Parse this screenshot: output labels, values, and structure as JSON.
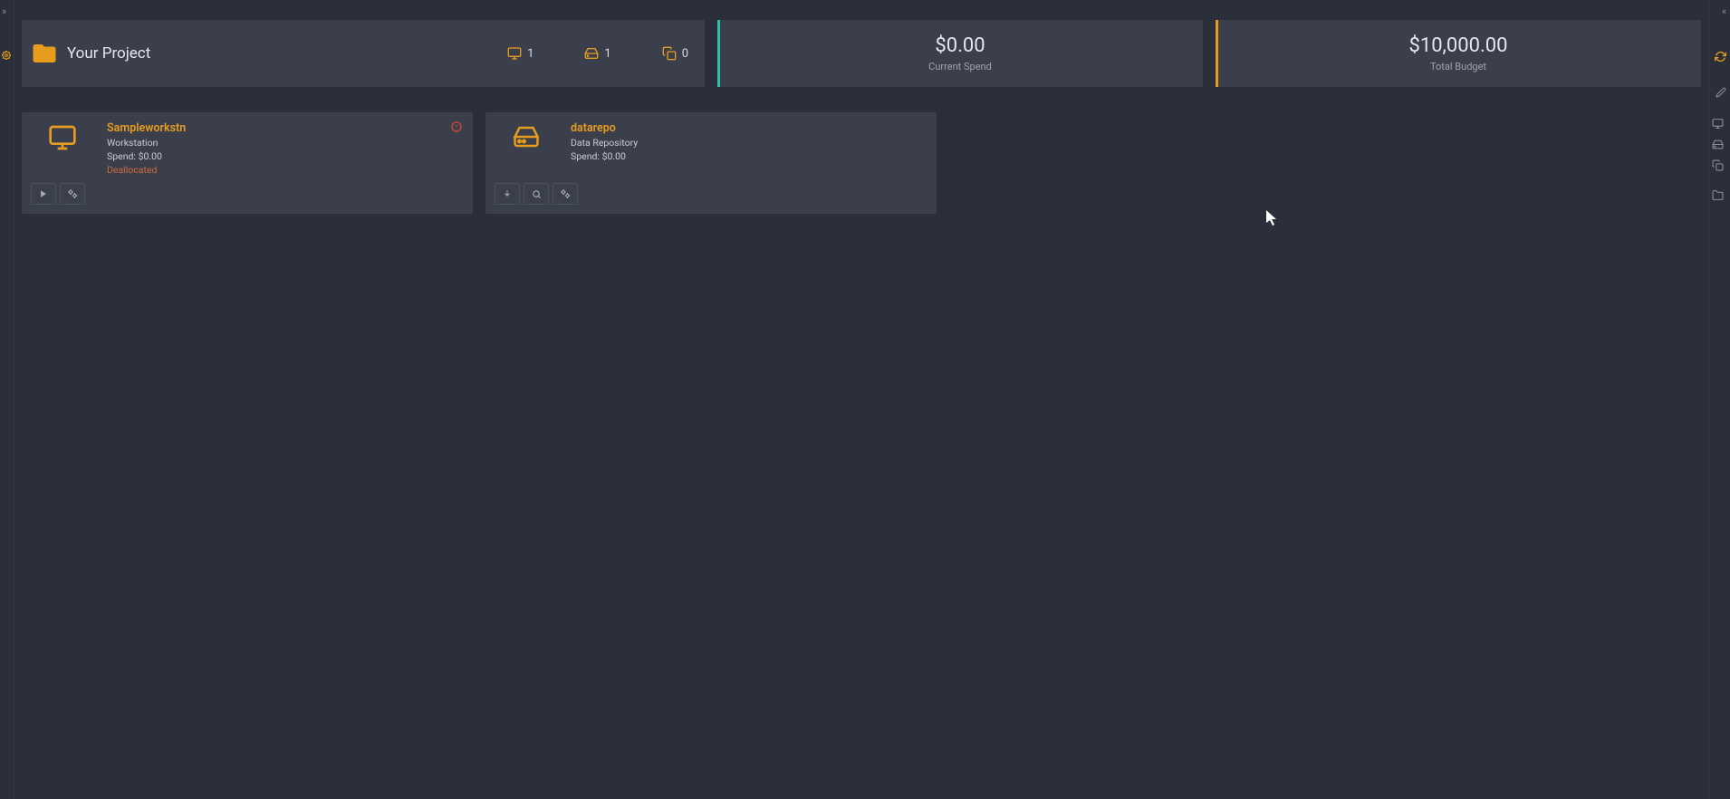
{
  "project": {
    "title": "Your Project",
    "stats": {
      "workstations": "1",
      "repos": "1",
      "clones": "0"
    }
  },
  "spend": {
    "value": "$0.00",
    "label": "Current Spend"
  },
  "budget": {
    "value": "$10,000.00",
    "label": "Total Budget"
  },
  "cards": {
    "workstation": {
      "name": "Sampleworkstn",
      "type": "Workstation",
      "spend_label": "Spend: $0.00",
      "status": "Deallocated"
    },
    "repo": {
      "name": "datarepo",
      "type": "Data Repository",
      "spend_label": "Spend: $0.00"
    }
  },
  "colors": {
    "accent": "#e89c1e",
    "teal": "#2dbfa3",
    "danger": "#c0473d",
    "warn_text": "#d2693b"
  }
}
